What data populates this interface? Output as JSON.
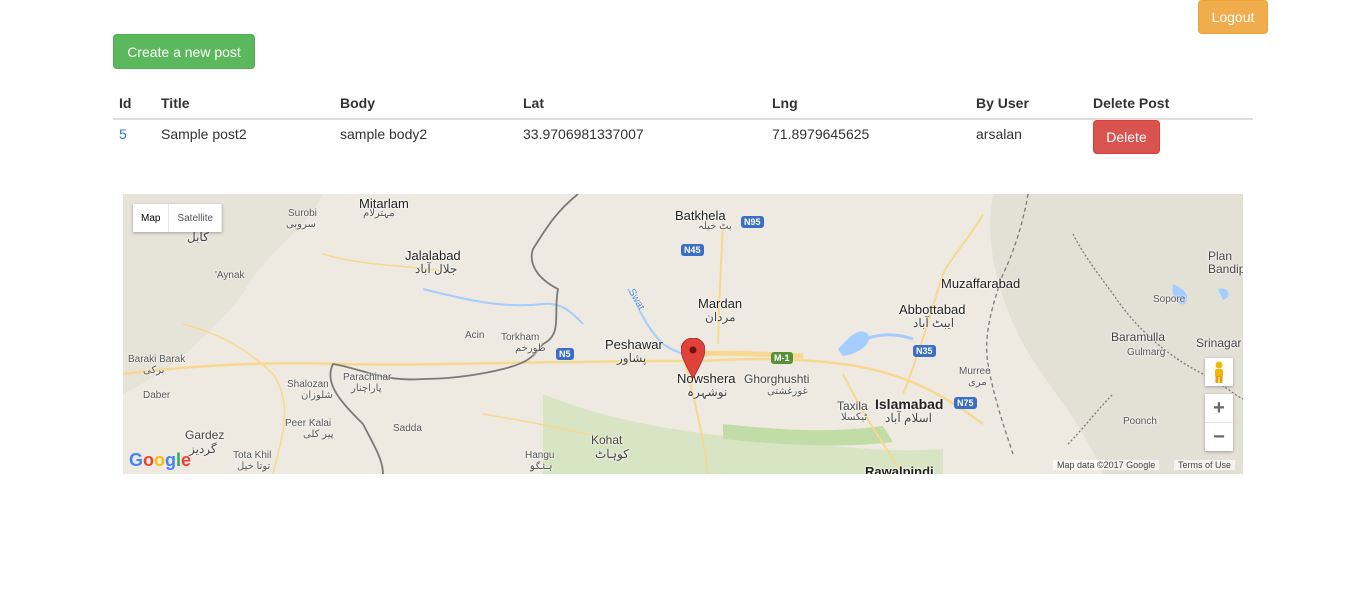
{
  "header": {
    "logout_label": "Logout",
    "create_label": "Create a new post"
  },
  "table": {
    "columns": [
      "Id",
      "Title",
      "Body",
      "Lat",
      "Lng",
      "By User",
      "Delete Post"
    ],
    "rows": [
      {
        "id": "5",
        "title": "Sample post2",
        "body": "sample body2",
        "lat": "33.9706981337007",
        "lng": "71.8979645625",
        "user": "arsalan",
        "delete_label": "Delete"
      }
    ]
  },
  "map": {
    "type_map": "Map",
    "type_satellite": "Satellite",
    "zoom_in": "+",
    "zoom_out": "−",
    "logo": "Google",
    "attribution": "Map data ©2017 Google",
    "terms": "Terms of Use",
    "labels": {
      "mitarlam": "Mitarlam",
      "mitarlam_ur": "مہترلام",
      "batkhela": "Batkhela",
      "batkhela_ur": "بٹ خیلہ",
      "surobi": "Surobi",
      "surobi_ur": "سروبی",
      "kabul_ur": "کابل",
      "aynak": "'Aynak",
      "jalalabad": "Jalalabad",
      "jalalabad_ur": "جلال آباد",
      "swat": "Swat",
      "mardan": "Mardan",
      "mardan_ur": "مردان",
      "muzaffarabad": "Muzaffarabad",
      "plan_bandipora": "Plan\nBandipora",
      "sopore": "Sopore",
      "abbottabad": "Abbottabad",
      "abbottabad_ur": "ایبٹ آباد",
      "baramulla": "Baramulla",
      "gulmarg": "Gulmarg",
      "srinagar": "Srinagar",
      "torkham": "Torkham",
      "torkham_ur": "طورخم",
      "acin": "Acin",
      "peshawar": "Peshawar",
      "peshawar_ur": "پشاور",
      "nowshera": "Nowshera",
      "nowshera_ur": "نوشہرہ",
      "ghorghushti": "Ghorghushti",
      "ghorghushti_ur": "غورغشتی",
      "baraki_barak": "Baraki Barak",
      "baraki_ur": "برکی",
      "parachinar": "Parachinar",
      "parachinar_ur": "پاراچنار",
      "shalozan": "Shalozan",
      "shalozan_ur": "شلوزان",
      "murree": "Murree",
      "murree_ur": "مری",
      "daber": "Daber",
      "taxila": "Taxila",
      "taxila_ur": "ٹیکسلا",
      "islamabad": "Islamabad",
      "islamabad_ur": "اسلام آباد",
      "peer_kalai": "Peer Kalai",
      "peer_kalai_ur": "پیر کلی",
      "sadda": "Sadda",
      "kohat": "Kohat",
      "kohat_ur": "کوہاٹ",
      "gardez": "Gardez",
      "gardez_ur": "گردیز",
      "poonch": "Poonch",
      "tota_khil": "Tota Khil",
      "tota_khil_ur": "توتا خیل",
      "hangu": "Hangu",
      "hangu_ur": "ہنگو",
      "rawalpindi": "Rawalpindi"
    },
    "shields": {
      "n95": "N95",
      "n45": "N45",
      "n5": "N5",
      "m1": "M-1",
      "n35": "N35",
      "n75": "N75"
    },
    "colors": {
      "marker": "#e0413b",
      "water": "#a3ccff",
      "road": "#f7d88f",
      "land": "#eeeae1"
    }
  }
}
